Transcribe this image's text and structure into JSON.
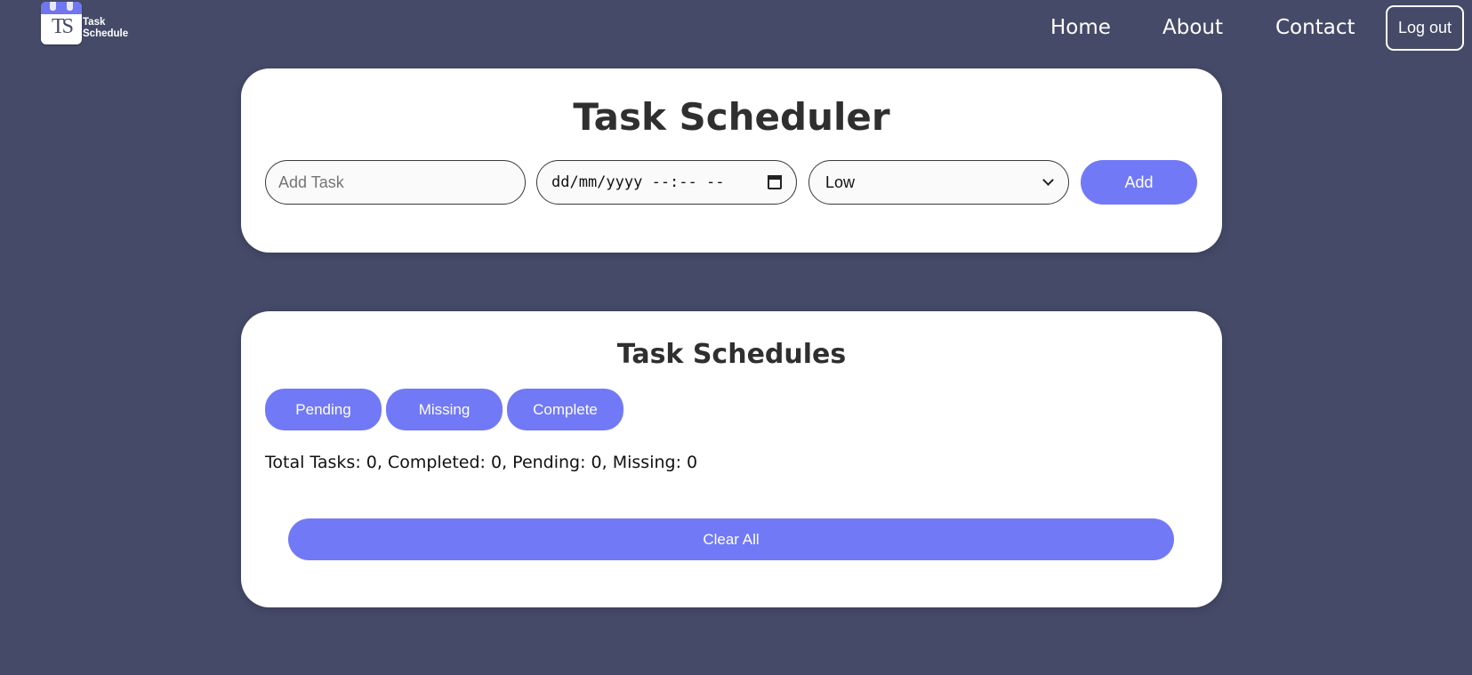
{
  "brand": {
    "logo_mark": "TS",
    "line1": "Task",
    "line2": "Schedule"
  },
  "nav": {
    "items": [
      {
        "label": "Home"
      },
      {
        "label": "About"
      },
      {
        "label": "Contact"
      }
    ],
    "logout_label": "Log out"
  },
  "scheduler": {
    "title": "Task Scheduler",
    "task_input": {
      "value": "",
      "placeholder": "Add Task"
    },
    "datetime_input": {
      "display": "dd/mm/yyyy --:-- --",
      "icon": "calendar-icon"
    },
    "priority_select": {
      "selected": "Low"
    },
    "add_label": "Add"
  },
  "schedules": {
    "title": "Task Schedules",
    "filters": [
      {
        "label": "Pending"
      },
      {
        "label": "Missing"
      },
      {
        "label": "Complete"
      }
    ],
    "stats": "Total Tasks: 0, Completed: 0, Pending: 0, Missing: 0",
    "clear_label": "Clear All"
  },
  "colors": {
    "background": "#454a68",
    "accent": "#7179f7",
    "card": "#ffffff",
    "title_text": "#2f2f2f"
  }
}
